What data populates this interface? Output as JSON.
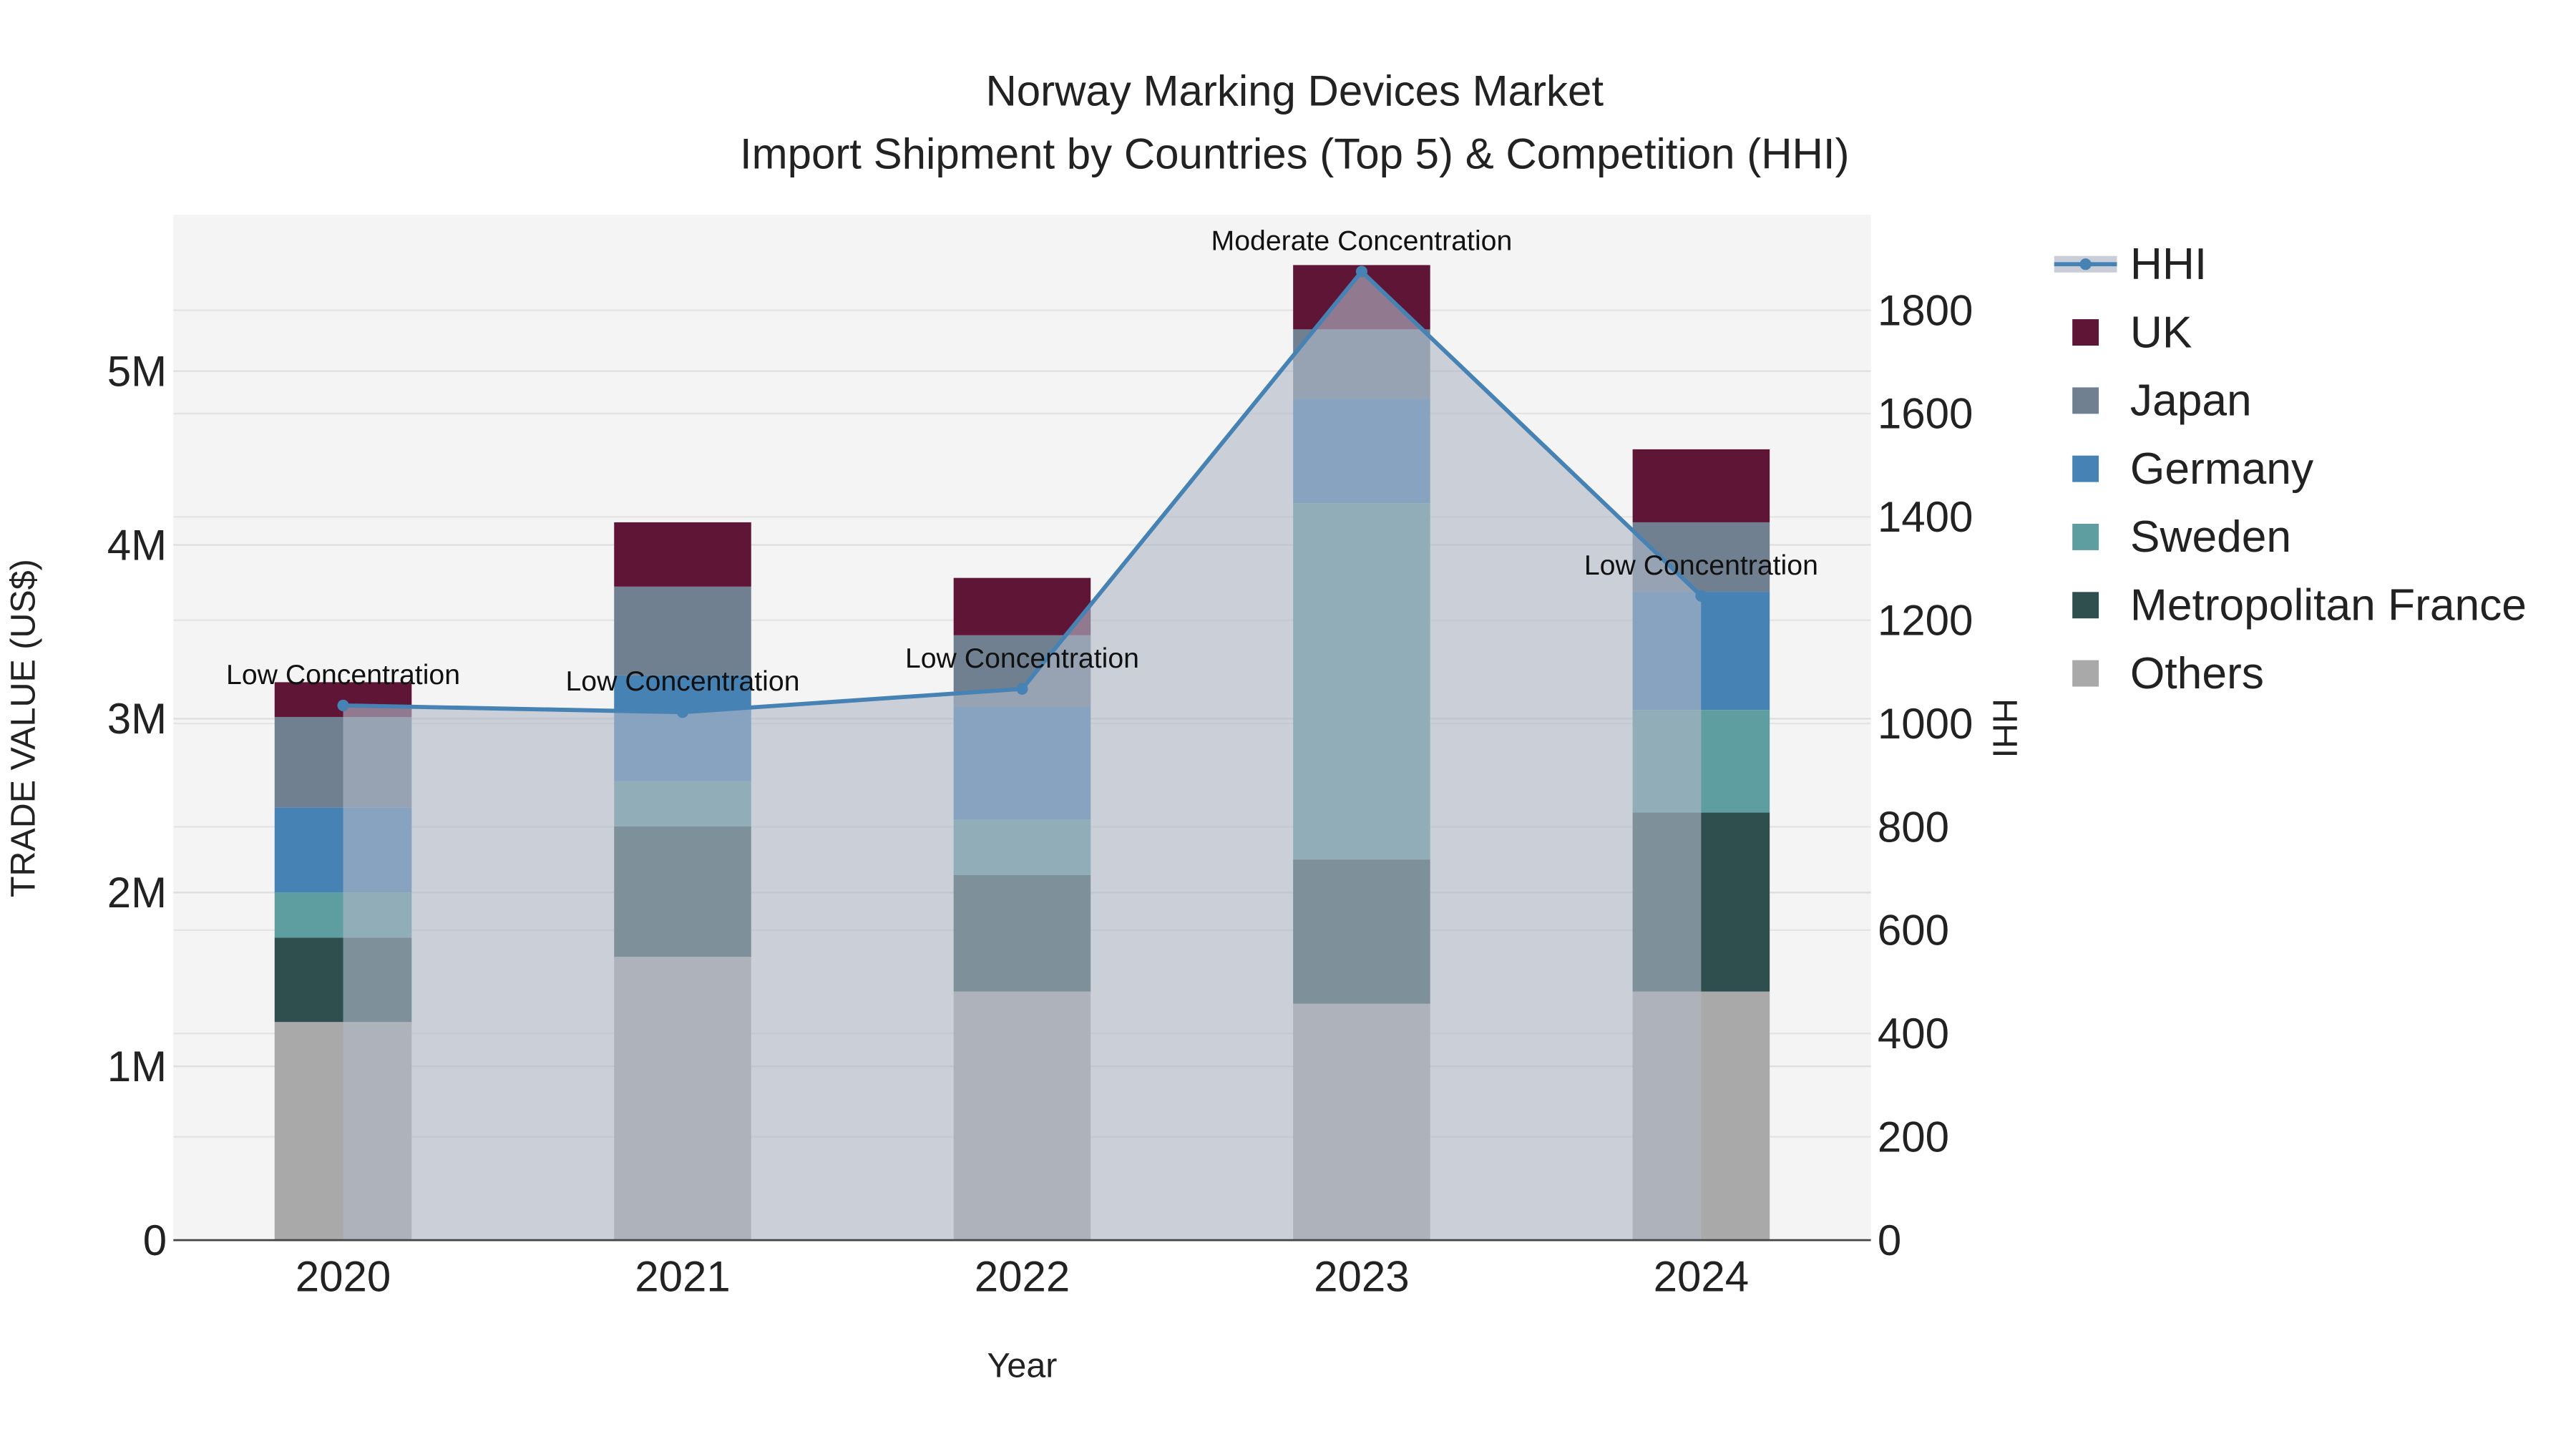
{
  "chart_data": {
    "type": "bar",
    "title": "Norway Marking Devices Market",
    "subtitle": "Import Shipment by Countries (Top 5) & Competition (HHI)",
    "xlabel": "Year",
    "ylabel": "TRADE VALUE (US$)",
    "y2label": "HHI",
    "categories": [
      "2020",
      "2021",
      "2022",
      "2023",
      "2024"
    ],
    "ylim": [
      0,
      5900000
    ],
    "y2lim": [
      0,
      1985
    ],
    "yticks": [
      0,
      1000000,
      2000000,
      3000000,
      4000000,
      5000000
    ],
    "ytick_labels": [
      "0",
      "1M",
      "2M",
      "3M",
      "4M",
      "5M"
    ],
    "y2ticks": [
      0,
      200,
      400,
      600,
      800,
      1000,
      1200,
      1400,
      1600,
      1800
    ],
    "y2tick_labels": [
      "0",
      "200",
      "400",
      "600",
      "800",
      "1000",
      "1200",
      "1400",
      "1600",
      "1800"
    ],
    "stacked": true,
    "series": [
      {
        "name": "Others",
        "color": "#a9a9a9",
        "values": [
          1255000,
          1630000,
          1430000,
          1360000,
          1430000
        ]
      },
      {
        "name": "Metropolitan France",
        "color": "#2f4f4f",
        "values": [
          485000,
          750000,
          670000,
          830000,
          1030000
        ]
      },
      {
        "name": "Sweden",
        "color": "#5f9ea0",
        "values": [
          260000,
          260000,
          320000,
          2050000,
          590000
        ]
      },
      {
        "name": "Germany",
        "color": "#4682b4",
        "values": [
          490000,
          610000,
          650000,
          600000,
          680000
        ]
      },
      {
        "name": "Japan",
        "color": "#708090",
        "values": [
          520000,
          510000,
          410000,
          400000,
          400000
        ]
      },
      {
        "name": "UK",
        "color": "#5f1535",
        "values": [
          200000,
          370000,
          330000,
          370000,
          420000
        ]
      }
    ],
    "line": {
      "name": "HHI",
      "color": "#4682b4",
      "values": [
        1035,
        1022,
        1067,
        1875,
        1247
      ]
    },
    "annotations": [
      "Low Concentration",
      "Low Concentration",
      "Low Concentration",
      "Moderate Concentration",
      "Low Concentration"
    ],
    "legend_order": [
      "HHI",
      "UK",
      "Japan",
      "Germany",
      "Sweden",
      "Metropolitan France",
      "Others"
    ],
    "legend_position": "right",
    "grid": true
  }
}
